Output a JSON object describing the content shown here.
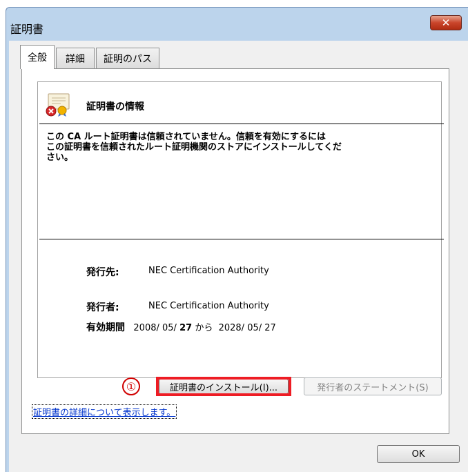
{
  "window": {
    "title": "証明書",
    "close_glyph": "✕"
  },
  "tabs": [
    {
      "label": "全般",
      "active": true
    },
    {
      "label": "詳細",
      "active": false
    },
    {
      "label": "証明のパス",
      "active": false
    }
  ],
  "info": {
    "icon": "certificate-error-icon",
    "title": "証明書の情報",
    "warning_lines": [
      "この CA ルート証明書は信頼されていません。信頼を有効にするには",
      "この証明書を信頼されたルート証明機関のストアにインストールしてくだ",
      "さい。"
    ],
    "issued_to_label": "発行先:",
    "issued_to": "NEC Certification Authority",
    "issued_by_label": "発行者:",
    "issued_by": "NEC Certification Authority",
    "validity_label": "有効期間",
    "valid_from_prefix": "2008/ 05/",
    "valid_from_day": "27",
    "valid_sep": "から",
    "valid_to": "2028/ 05/ 27"
  },
  "buttons": {
    "install": "証明書のインストール(I)...",
    "statement": "発行者のステートメント(S)",
    "ok": "OK"
  },
  "annotation": {
    "marker": "①",
    "highlight_color": "#ee1c24"
  },
  "link": {
    "details": "証明書の詳細について表示します。"
  }
}
